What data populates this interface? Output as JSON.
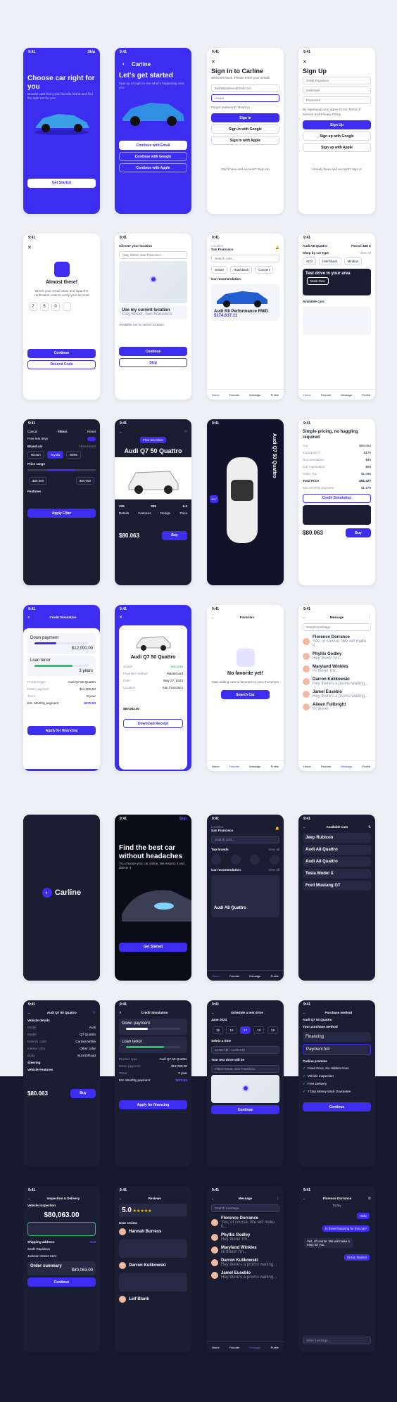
{
  "status_time": "9:41",
  "brand": "Carline",
  "onboarding": {
    "skip": "Skip",
    "title": "Choose car right for you",
    "subtitle": "Browse cars from your favorite brand and find the right car for you",
    "cta": "Get Started"
  },
  "welcome": {
    "title": "Let's get started",
    "subtitle": "Sign up or login to see what's happening near you",
    "email": "Continue with Email",
    "google": "Continue with Google",
    "apple": "Continue with Apple"
  },
  "signin": {
    "title": "Sign in to Carline",
    "subtitle": "Welcome back. Please enter your details",
    "email": "sadraspadeve@mail.com",
    "password": "••••••••",
    "forgot": "Forgot password? Reset in",
    "cta": "Sign in",
    "google": "Sign in with Google",
    "apple": "Sign in with Apple",
    "footer": "Don't have and account? Sign Up"
  },
  "signup": {
    "title": "Sign Up",
    "name": "Saski Rapideva",
    "user": "saskirapi/",
    "password": "Password",
    "terms": "By signing up, you agree to our Terms of Service and Privacy Policy",
    "cta": "Sign Up",
    "google": "Sign up with Google",
    "apple": "Sign up with Apple",
    "footer": "Already have and account? Sign in"
  },
  "otp": {
    "title": "Almost there!",
    "subtitle": "Check your email inbox and input the verification code to verify your account",
    "digits": [
      "7",
      "5",
      "0",
      ""
    ],
    "cta": "Continue",
    "resend": "Resend Code"
  },
  "location": {
    "title": "Choose your location",
    "search": "Clay Street. San Francisco",
    "current": "Use my current location",
    "current_sub": "Clay Street, San Francisco",
    "note": "Available car in current location",
    "cta": "Continue",
    "skip": "Skip"
  },
  "home": {
    "loc_label": "Location",
    "loc": "San Francisco",
    "search": "Search cars...",
    "tabs": [
      "Sedan",
      "Hatchback",
      "Convert"
    ],
    "rec": "Car recomendation",
    "car": "Audi R8 Performance RWD",
    "price": "$174,637.11",
    "nav": [
      "Home",
      "Favorite",
      "Message",
      "Profile"
    ]
  },
  "home2": {
    "shop": "Shop by car type",
    "view_all": "View All",
    "types": [
      "SUV",
      "Hatchback",
      "Minibus"
    ],
    "test": "Test drive in your area",
    "book": "Book Now",
    "available": "Available cars",
    "car1": "Audi A8 Quattro",
    "car2": "Ferrari 488 S"
  },
  "filters": {
    "title": "Filters",
    "reset": "Reset",
    "cancel": "Cancel",
    "test": "Free test drive",
    "brand": "Brand car",
    "more": "More brand",
    "brands": [
      "Nissan",
      "Toyota",
      "BMW"
    ],
    "price": "Price range",
    "min": "$35,000",
    "max": "$80,000",
    "features": "Features",
    "cta": "Apply Filter"
  },
  "detail": {
    "badge": "Free test drive",
    "name": "Audi Q7 50 Quattro",
    "stats": [
      "335",
      "369",
      "6.4"
    ],
    "tabs": [
      "Details",
      "Features",
      "Design",
      "Price"
    ],
    "price": "$80.063",
    "cta": "Buy"
  },
  "gallery": {
    "name": "Audi Q7 50 Quattro",
    "view": "360°"
  },
  "pricing": {
    "title": "Simple pricing, no haggling required",
    "rows": [
      [
        "Car",
        "$80,063"
      ],
      [
        "Import MOT",
        "$175"
      ],
      [
        "Documentation",
        "$45"
      ],
      [
        "Car registration",
        "$99"
      ],
      [
        "Sales Tax",
        "$1,095"
      ]
    ],
    "total_label": "Total Price",
    "total": "$81,477",
    "est_label": "Est. Monthly payment",
    "est": "$1,579",
    "sim": "Credit Simulation",
    "price": "$80.063",
    "cta": "Buy"
  },
  "credit": {
    "title": "Credit Simulation",
    "down": "Down payment",
    "down_val": "$12,000.00",
    "loan": "Loan tenor",
    "loan_val": "3 years",
    "rows": [
      [
        "Product type",
        "Audi Q7 50 Quattro"
      ],
      [
        "Down payment",
        "$12,000.00"
      ],
      [
        "Tenor",
        "3 year"
      ]
    ],
    "monthly_label": "Est. Monthly payment",
    "monthly": "$970.00",
    "cta": "Apply for financing"
  },
  "receipt": {
    "name": "Audi Q7 50 Quattro",
    "rows": [
      [
        "Status",
        "Success"
      ],
      [
        "Payment method",
        "Mastercard"
      ],
      [
        "Date",
        "May 27, 2023"
      ],
      [
        "Location",
        "San Francisco"
      ]
    ],
    "total": "$80,063.00",
    "cta": "Download Receipt"
  },
  "favorites": {
    "title": "Favorites",
    "empty": "No favorite yet!",
    "sub": "Start adding cars to favorites to view them here",
    "cta": "Search Car"
  },
  "messages": {
    "title": "Message",
    "search": "Search message",
    "items": [
      [
        "Florence Dorrance",
        "Yes, of course. We will make it..."
      ],
      [
        "Phyllis Godley",
        "Hey there! I'm..."
      ],
      [
        "Maryland Winkles",
        "Hi there! I'm..."
      ],
      [
        "Darron Kulikowski",
        "Hey there's a promo waiting..."
      ],
      [
        "Jamel Eusebio",
        "Hey there's a promo waiting..."
      ],
      [
        "Aileen Fullbright",
        "Hi there!"
      ]
    ]
  },
  "splash": {
    "name": "Carline"
  },
  "hero": {
    "skip": "Skip",
    "title": "Find the best car without headaches",
    "sub": "You choose your car online. We inspect it and deliver it.",
    "cta": "Get Started"
  },
  "dark_home": {
    "brands": "Top brands",
    "view_all": "View all",
    "rec": "Car recomendation",
    "car": "Audi A8 Quattro"
  },
  "available": {
    "title": "Available cars",
    "cars": [
      "Jeep Rubicon",
      "Audi A8 Quattro",
      "Audi A8 Quattro",
      "Tesla Model X",
      "Ford Mustang GT"
    ]
  },
  "dark_detail": {
    "name": "Audi Q7 50 Quattro",
    "vehicle": "Vehicle details",
    "rows": [
      [
        "Model",
        "Audi"
      ],
      [
        "Model",
        "Q7 Quattro"
      ],
      [
        "Exterior color",
        "Carrara White"
      ],
      [
        "Interior color",
        "Other color"
      ],
      [
        "Body",
        "SUV/Offroad"
      ]
    ],
    "steering": "Steering",
    "vfeat": "Vehicle Features",
    "price": "$80.063",
    "cta": "Buy"
  },
  "schedule": {
    "title": "Schedule a test drive",
    "month": "June 2023",
    "days": [
      "15",
      "16",
      "17",
      "18",
      "19"
    ],
    "time": "Select a time",
    "time_val": "10:00 AM - 11:00 AM",
    "where": "Your test drive will be",
    "addr": "Filbert street, San Francisco",
    "cta": "Continue"
  },
  "purchase": {
    "title": "Purchase method",
    "car": "Audi Q7 50 Quattro",
    "method": "Your purchase method",
    "opts": [
      "Financing",
      "Payment full"
    ],
    "promise": "Carline promise",
    "promises": [
      "Fixed Price, No Hidden Fees",
      "Vehicle Inspection",
      "Free Delivery",
      "7 Day Money Back Guarantee"
    ],
    "cta": "Continue"
  },
  "inspection": {
    "title": "Inspection & Delivery",
    "vi": "Vehicle inspection",
    "amount": "$80,063.00",
    "ship": "Shipping address",
    "edit": "Edit",
    "name": "Saski Rapideva",
    "street": "Jackson Street 1124",
    "summary": "Order summary",
    "s_total": "$80,063.00",
    "cta": "Continue"
  },
  "reviews": {
    "title": "Reviews",
    "score": "5.0",
    "user": "User review",
    "names": [
      "Hannah Burress",
      "Darron Kulikowski",
      "Leif Blank"
    ]
  },
  "chat": {
    "name": "Florence Dorrance",
    "day": "Today",
    "bubbles": [
      "Hello",
      "Is there financing for this car?",
      "Yes, of course. We will make it easy for you",
      "Great, thanks!"
    ],
    "input": "Write message..."
  }
}
